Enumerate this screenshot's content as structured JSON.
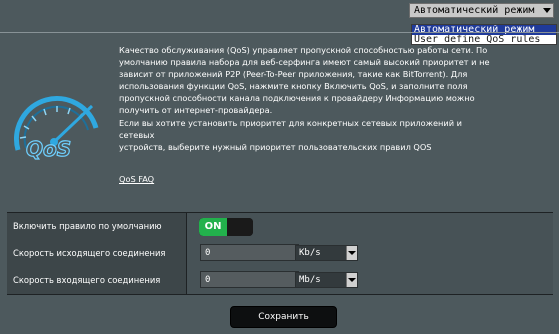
{
  "mode": {
    "selected": "Автоматический режим",
    "options": [
      "Автоматический режим",
      "User define QoS rules"
    ]
  },
  "logo": {
    "text": "QoS"
  },
  "description": {
    "lines": [
      "Качество обслуживания (QoS) управляет пропускной способностью работы сети. По",
      "умолчанию правила набора для веб-серфинга имеют самый высокий приоритет и не",
      "зависит от приложений P2P (Peer-To-Peer приложения, такие как BitTorrent). Для",
      "использования функции QoS, нажмите кнопку Включить QoS, и заполните поля",
      "пропускной способности канала подключения к провайдеру Информацию можно",
      "получить от интернет-провайдера.",
      "Если вы хотите установить приоритет для конкретных сетевых приложений и сетевых",
      "устройств, выберите нужный приоритет пользовательских правил QOS"
    ],
    "faq_link": "QoS FAQ"
  },
  "settings": {
    "default_rule": {
      "label": "Включить правило по умолчанию",
      "toggle": "ON"
    },
    "upload": {
      "label": "Скорость исходящего соединения",
      "value": "0",
      "unit": "Kb/s"
    },
    "download": {
      "label": "Скорость входящего соединения",
      "value": "0",
      "unit": "Mb/s"
    }
  },
  "save_button": "Сохранить",
  "colors": {
    "background": "#4d595d",
    "toggle_on": "#22b14c",
    "selected_option": "#1f3a9a",
    "logo_blue": "#2fa8e0"
  }
}
